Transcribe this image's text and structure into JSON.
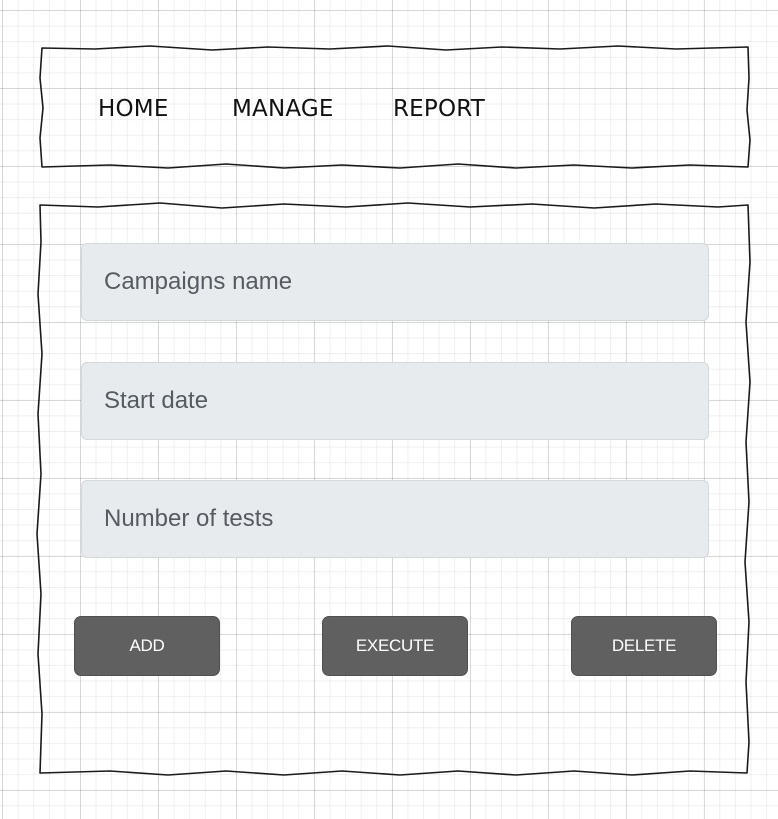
{
  "navbar": {
    "items": [
      {
        "label": "HOME"
      },
      {
        "label": "MANAGE"
      },
      {
        "label": "REPORT"
      }
    ]
  },
  "form": {
    "fields": [
      {
        "placeholder": "Campaigns name",
        "value": ""
      },
      {
        "placeholder": "Start date",
        "value": ""
      },
      {
        "placeholder": "Number of tests",
        "value": ""
      }
    ],
    "buttons": [
      {
        "label": "ADD"
      },
      {
        "label": "EXECUTE"
      },
      {
        "label": "DELETE"
      }
    ]
  },
  "colors": {
    "field_background": "#e8ebee",
    "button_background": "#606060",
    "button_text": "#ffffff",
    "sketch_stroke": "#1a1a1a"
  }
}
